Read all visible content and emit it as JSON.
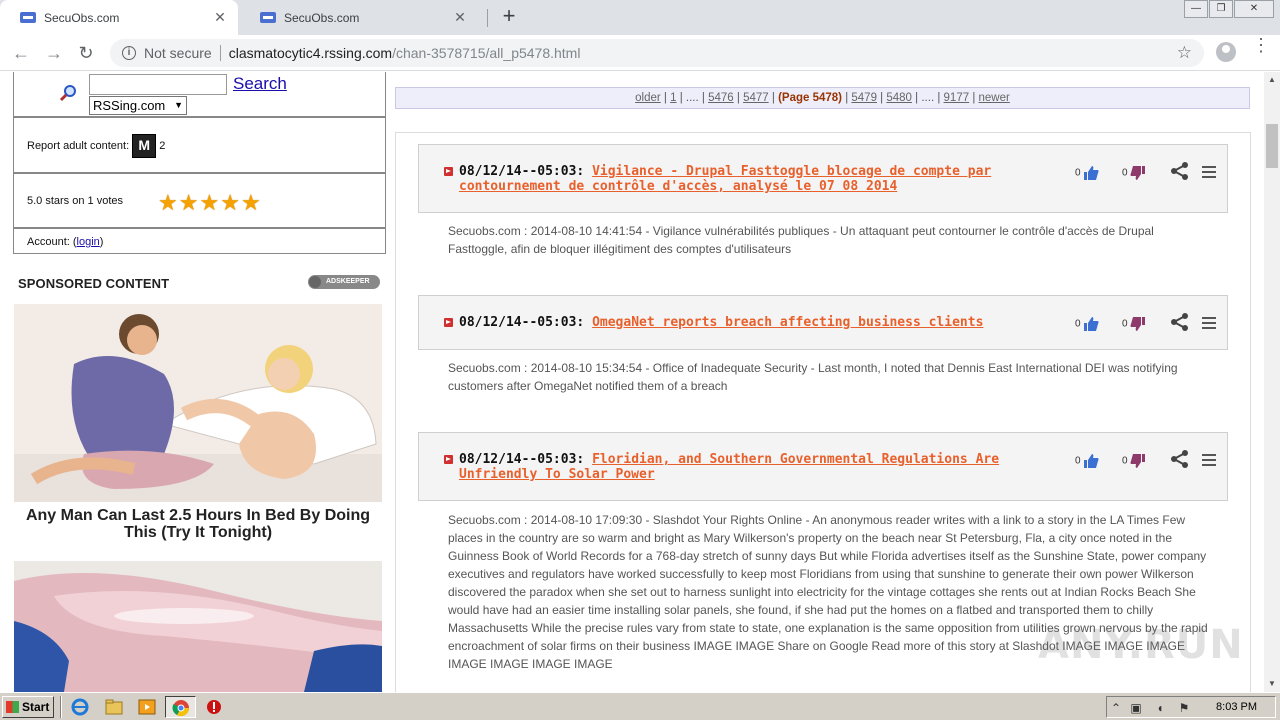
{
  "browser": {
    "tabs": [
      {
        "title": "SecuObs.com",
        "active": true
      },
      {
        "title": "SecuObs.com",
        "active": false
      }
    ],
    "new_tab_label": "+",
    "security_label": "Not secure",
    "url_host": "clasmatocytic4.rssing.com",
    "url_path": "/chan-3578715/all_p5478.html"
  },
  "sidebar": {
    "search_label": "Search",
    "select_value": "RSSing.com",
    "report_label": "Report adult content:",
    "report_badge": "M",
    "report_count": "2",
    "rating_text": "5.0 stars on 1 votes",
    "rating_value": 5,
    "rating_max": 5,
    "account_prefix": "Account: (",
    "account_link": "login",
    "account_suffix": ")",
    "sponsored_heading": "SPONSORED CONTENT",
    "adskeeper_label": "ADSKEEPER",
    "ad1_caption": "Any Man Can Last 2.5 Hours In Bed By Doing This (Try It Tonight)"
  },
  "pager": {
    "older": "older",
    "p1": "1",
    "ellipsis1": "....",
    "p5476": "5476",
    "p5477": "5477",
    "current": "(Page 5478)",
    "p5479": "5479",
    "p5480": "5480",
    "ellipsis2": "....",
    "p9177": "9177",
    "newer": "newer"
  },
  "entries": [
    {
      "date": "08/12/14--05:03:",
      "title": "Vigilance - Drupal Fasttoggle blocage de compte par contournement de contrôle d'accès, analysé le 07 08 2014",
      "up": "0",
      "down": "0",
      "body": "Secuobs.com : 2014-08-10 14:41:54 - Vigilance vulnérabilités publiques - Un attaquant peut contourner le contrôle d'accès de Drupal Fasttoggle, afin de bloquer illégitiment des comptes d'utilisateurs"
    },
    {
      "date": "08/12/14--05:03:",
      "title": "OmegaNet reports breach affecting business clients",
      "up": "0",
      "down": "0",
      "body": "Secuobs.com : 2014-08-10 15:34:54 - Office of Inadequate Security - Last month, I noted that Dennis East International DEI was notifying customers after OmegaNet notified them of a breach"
    },
    {
      "date": "08/12/14--05:03:",
      "title": "Floridian, and Southern Governmental Regulations Are Unfriendly To Solar Power",
      "up": "0",
      "down": "0",
      "body": "Secuobs.com : 2014-08-10 17:09:30 - Slashdot Your Rights Online - An anonymous reader writes with a link to a story in the LA Times Few places in the country are so warm and bright as Mary Wilkerson's property on the beach near St Petersburg, Fla, a city once noted in the Guinness Book of World Records for a 768-day stretch of sunny days But while Florida advertises itself as the Sunshine State, power company executives and regulators have worked successfully to keep most Floridians from using that sunshine to generate their own power Wilkerson discovered the paradox when she set out to harness sunlight into electricity for the vintage cottages she rents out at Indian Rocks Beach She would have had an easier time installing solar panels, she found, if she had put the homes on a flatbed and transported them to chilly Massachusetts While the precise rules vary from state to state, one explanation is the same opposition from utilities grown nervous by the rapid encroachment of solar firms on their business IMAGE IMAGE Share on Google Read more of this story at Slashdot IMAGE IMAGE IMAGE IMAGE IMAGE IMAGE IMAGE"
    }
  ],
  "watermark": "ANY.RUN",
  "taskbar": {
    "start_label": "Start",
    "clock": "8:03 PM"
  }
}
